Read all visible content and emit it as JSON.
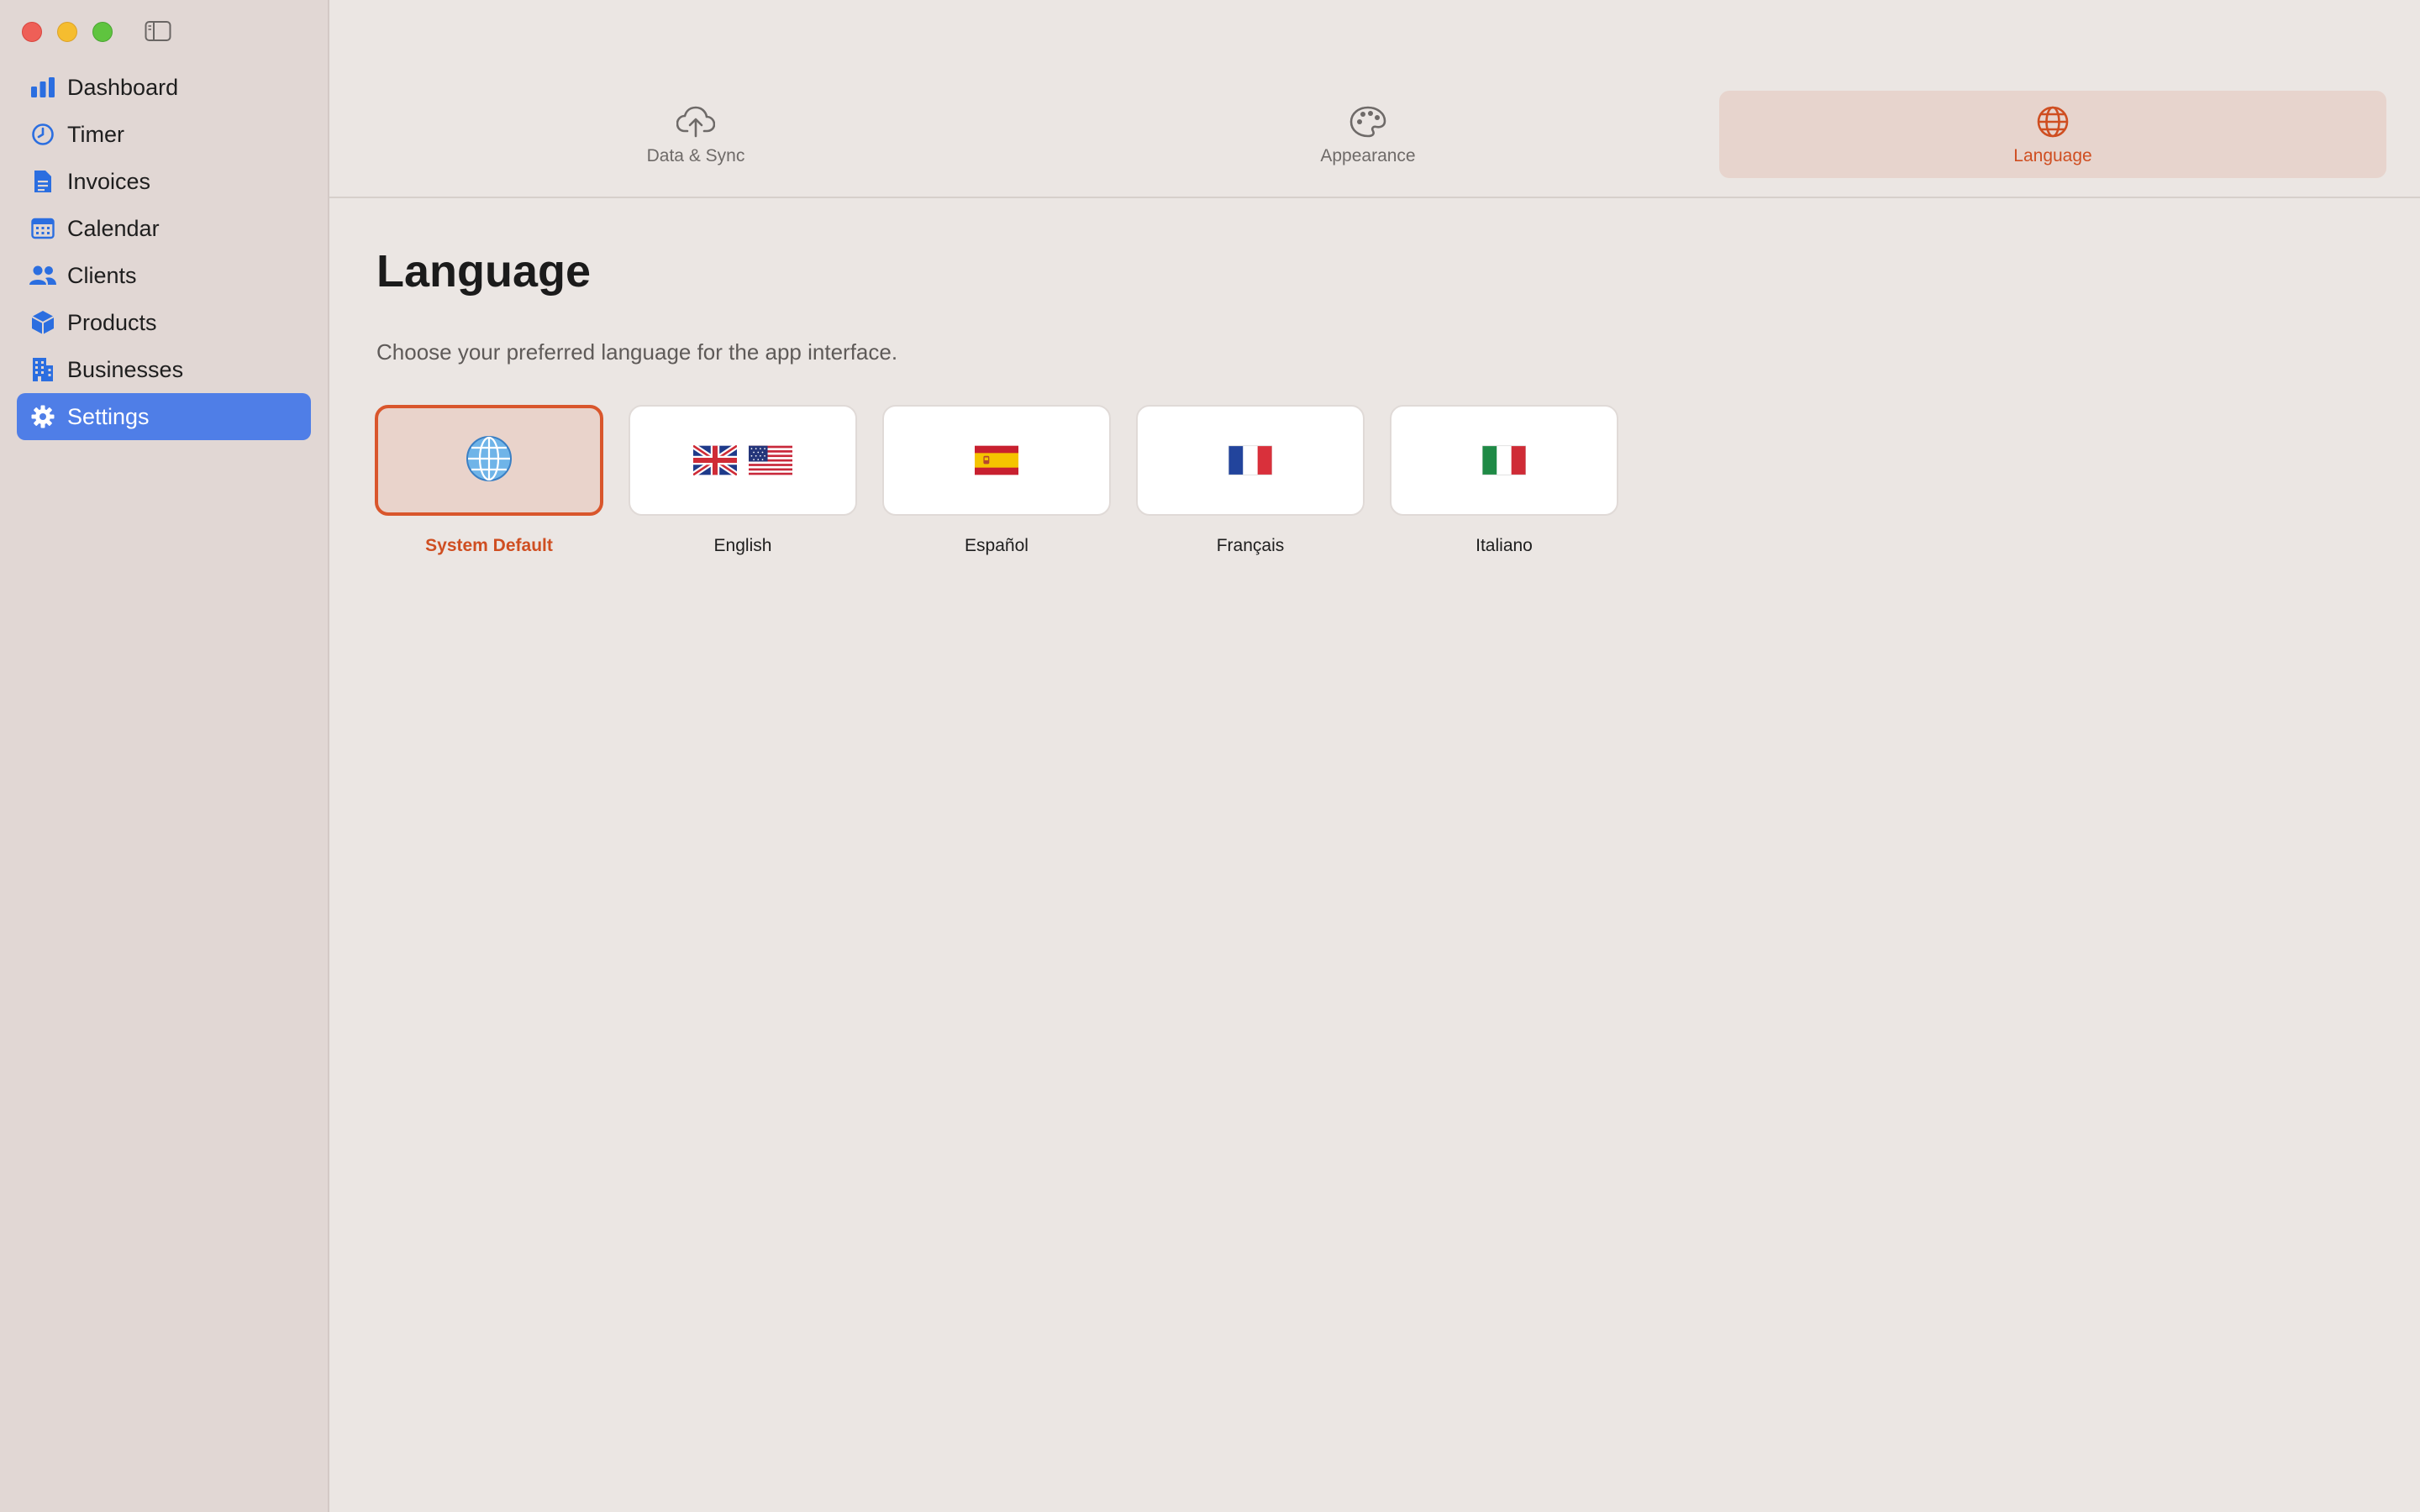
{
  "sidebar": {
    "items": [
      {
        "label": "Dashboard",
        "icon": "chart-bar-icon"
      },
      {
        "label": "Timer",
        "icon": "timer-icon"
      },
      {
        "label": "Invoices",
        "icon": "document-icon"
      },
      {
        "label": "Calendar",
        "icon": "calendar-icon"
      },
      {
        "label": "Clients",
        "icon": "people-icon"
      },
      {
        "label": "Products",
        "icon": "box-icon"
      },
      {
        "label": "Businesses",
        "icon": "building-icon"
      },
      {
        "label": "Settings",
        "icon": "gear-icon",
        "active": true
      }
    ]
  },
  "tabs": [
    {
      "label": "Data & Sync",
      "icon": "cloud-upload-icon"
    },
    {
      "label": "Appearance",
      "icon": "palette-icon"
    },
    {
      "label": "Language",
      "icon": "globe-icon",
      "active": true
    }
  ],
  "page": {
    "title": "Language",
    "description": "Choose your preferred language for the app interface."
  },
  "languages": [
    {
      "label": "System Default",
      "icon": "globe-emoji-icon",
      "selected": true
    },
    {
      "label": "English",
      "icon": "uk-us-flags-icon"
    },
    {
      "label": "Español",
      "icon": "spain-flag-icon"
    },
    {
      "label": "Français",
      "icon": "france-flag-icon"
    },
    {
      "label": "Italiano",
      "icon": "italy-flag-icon"
    }
  ],
  "colors": {
    "accent": "#cf4e21",
    "sidebar_active": "#4f7ee7",
    "icon_blue": "#2b6ee0"
  }
}
